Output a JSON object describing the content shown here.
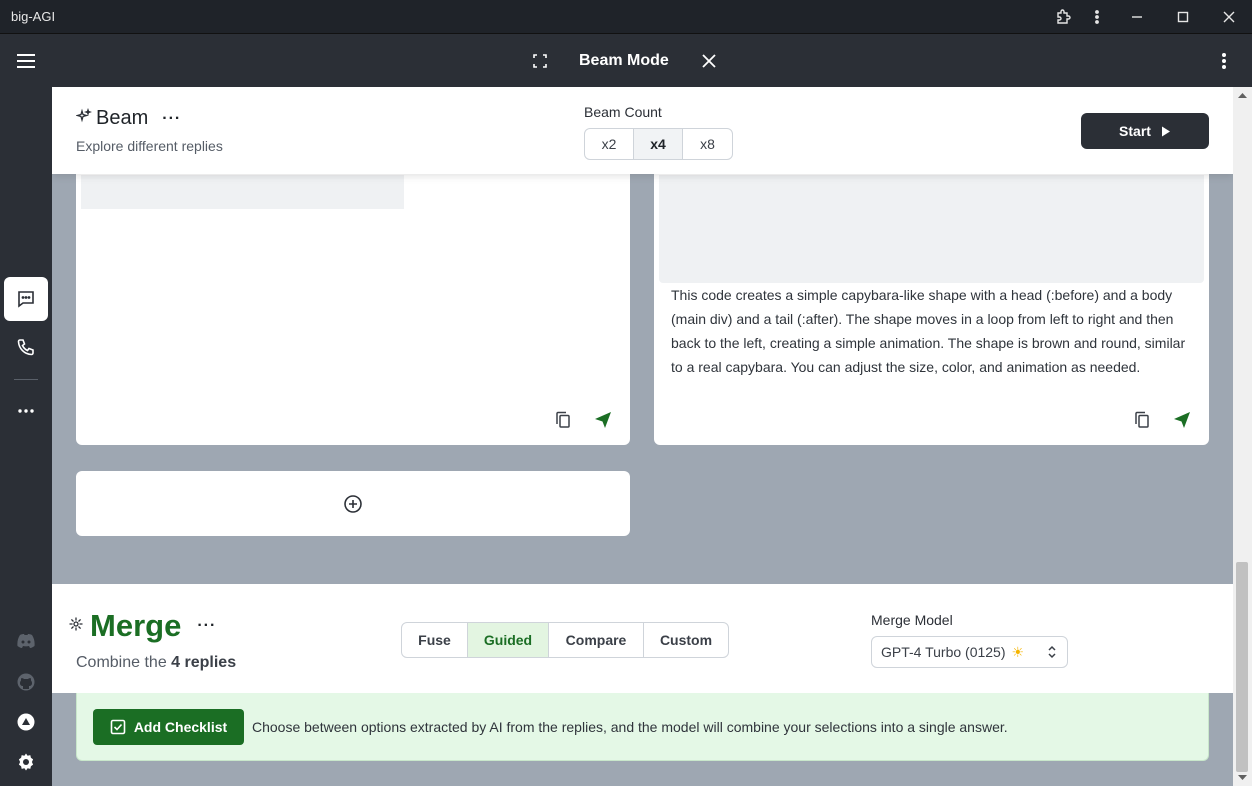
{
  "window": {
    "title": "big-AGI"
  },
  "header": {
    "title": "Beam Mode"
  },
  "beam": {
    "title": "Beam",
    "subtitle": "Explore different replies",
    "count_label": "Beam Count",
    "counts": [
      "x2",
      "x4",
      "x8"
    ],
    "selected_count": "x4",
    "start_label": "Start"
  },
  "replies": {
    "card2_text": "This code creates a simple capybara-like shape with a head (:before) and a body (main div) and a tail (:after). The shape moves in a loop from left to right and then back to the left, creating a simple animation. The shape is brown and round, similar to a real capybara. You can adjust the size, color, and animation as needed."
  },
  "merge": {
    "title": "Merge",
    "subtitle_prefix": "Combine the",
    "subtitle_count": "4 replies",
    "methods": [
      "Fuse",
      "Guided",
      "Compare",
      "Custom"
    ],
    "selected_method": "Guided",
    "model_label": "Merge Model",
    "model_value": "GPT-4 Turbo (0125)",
    "model_badge": "☀",
    "guided_button": "Add Checklist",
    "guided_description": "Choose between options extracted by AI from the replies, and the model will combine your selections into a single answer."
  },
  "colors": {
    "accent_green": "#1b6e24",
    "dark": "#2b2f36"
  }
}
